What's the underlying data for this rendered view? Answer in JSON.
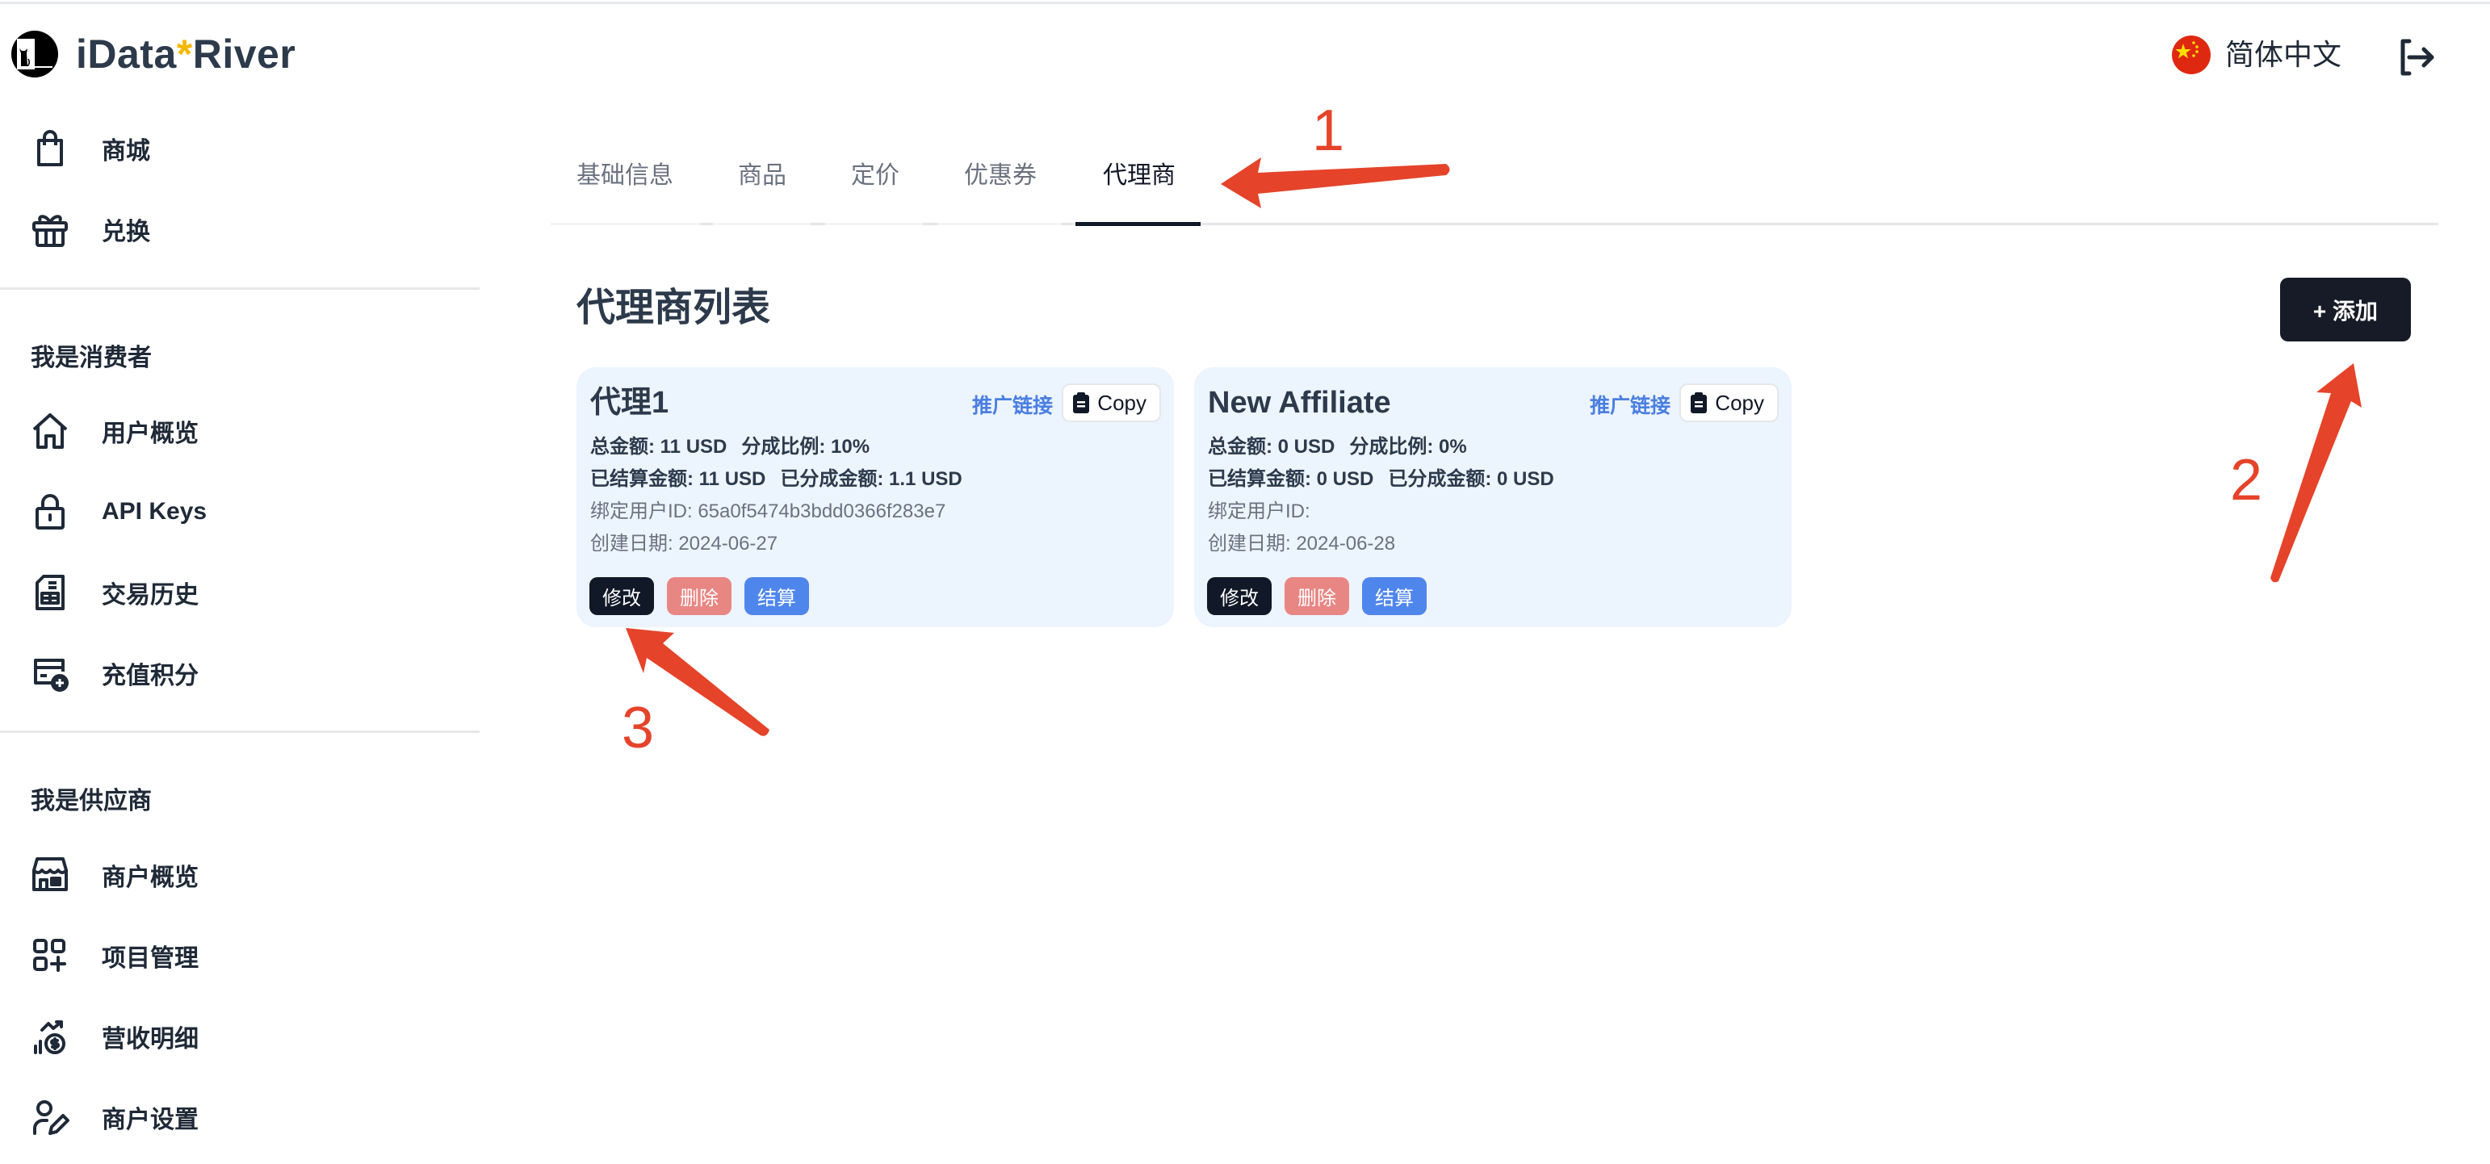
{
  "brand": {
    "name_left": "iData",
    "name_star": "*",
    "name_right": "River",
    "logo_icon": "cat-logo-icon"
  },
  "header": {
    "language": "简体中文",
    "language_flag": "china-flag-icon",
    "logout_icon": "logout-icon"
  },
  "sidebar": {
    "top_items": [
      {
        "label": "商城",
        "icon": "shopping-bag-icon"
      },
      {
        "label": "兑换",
        "icon": "gift-icon"
      }
    ],
    "consumer_section": {
      "title": "我是消费者",
      "items": [
        {
          "label": "用户概览",
          "icon": "home-icon"
        },
        {
          "label": "API Keys",
          "icon": "lock-icon"
        },
        {
          "label": "交易历史",
          "icon": "receipt-icon"
        },
        {
          "label": "充值积分",
          "icon": "card-plus-icon"
        }
      ]
    },
    "supplier_section": {
      "title": "我是供应商",
      "items": [
        {
          "label": "商户概览",
          "icon": "store-icon"
        },
        {
          "label": "项目管理",
          "icon": "grid-plus-icon"
        },
        {
          "label": "营收明细",
          "icon": "revenue-icon"
        },
        {
          "label": "商户设置",
          "icon": "user-edit-icon"
        }
      ]
    }
  },
  "tabs": [
    {
      "label": "基础信息",
      "active": false
    },
    {
      "label": "商品",
      "active": false
    },
    {
      "label": "定价",
      "active": false
    },
    {
      "label": "优惠券",
      "active": false
    },
    {
      "label": "代理商",
      "active": true
    }
  ],
  "main": {
    "heading": "代理商列表",
    "add_button": "+ 添加",
    "affiliates": [
      {
        "name": "代理1",
        "promo_link_label": "推广链接",
        "copy_label": "Copy",
        "total_amount": "总金额: 11 USD",
        "share_ratio": "分成比例: 10%",
        "settled_amount": "已结算金额: 11 USD",
        "shared_amount": "已分成金额: 1.1 USD",
        "bound_user": "绑定用户ID: 65a0f5474b3bdd0366f283e7",
        "created": "创建日期: 2024-06-27",
        "edit_label": "修改",
        "delete_label": "删除",
        "settle_label": "结算"
      },
      {
        "name": "New Affiliate",
        "promo_link_label": "推广链接",
        "copy_label": "Copy",
        "total_amount": "总金额: 0 USD",
        "share_ratio": "分成比例: 0%",
        "settled_amount": "已结算金额: 0 USD",
        "shared_amount": "已分成金额: 0 USD",
        "bound_user": "绑定用户ID:",
        "created": "创建日期: 2024-06-28",
        "edit_label": "修改",
        "delete_label": "删除",
        "settle_label": "结算"
      }
    ]
  },
  "annotations": [
    {
      "number": "1",
      "target": "代理商 tab"
    },
    {
      "number": "2",
      "target": "+ 添加 button"
    },
    {
      "number": "3",
      "target": "修改 button"
    }
  ],
  "colors": {
    "primary_dark": "#111827",
    "delete_red": "#e88683",
    "settle_blue": "#4f86ec",
    "link_blue": "#4a7fe0",
    "card_bg": "#ecf4fe",
    "brand_star": "#f5b800",
    "annotation_red": "#e5432a"
  }
}
